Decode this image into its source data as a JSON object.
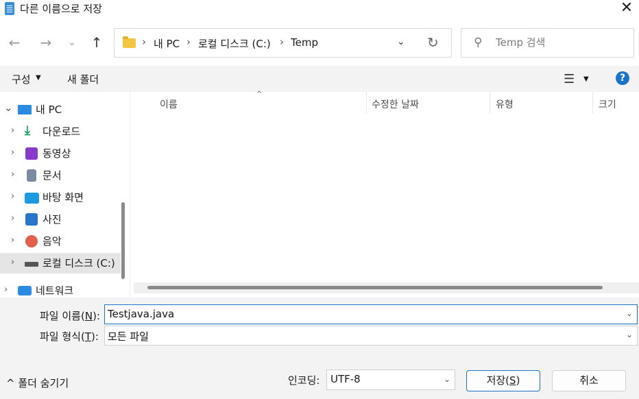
{
  "window": {
    "title": "다른 이름으로 저장",
    "close_glyph": "✕"
  },
  "nav": {
    "back_glyph": "←",
    "forward_glyph": "→",
    "recent_glyph": "⌄",
    "up_glyph": "↑",
    "breadcrumb": [
      "내 PC",
      "로컬 디스크 (C:)",
      "Temp"
    ],
    "crumb_sep": "›",
    "dropdown_glyph": "⌄",
    "refresh_glyph": "↻"
  },
  "search": {
    "placeholder": "Temp 검색",
    "icon": "search-icon"
  },
  "toolbar": {
    "organize_label": "구성",
    "organize_caret": "▼",
    "new_folder_label": "새 폴더",
    "view_glyph": "☰",
    "view_caret": "▼",
    "help_glyph": "?"
  },
  "sidebar": {
    "items": [
      {
        "label": "내 PC",
        "icon": "computer-icon",
        "caret": "⌄",
        "color": "#2a8be0"
      },
      {
        "label": "다운로드",
        "icon": "download-icon",
        "caret": "›",
        "color": "#1aa35a"
      },
      {
        "label": "동영상",
        "icon": "video-icon",
        "caret": "›",
        "color": "#8a3ac9"
      },
      {
        "label": "문서",
        "icon": "document-icon",
        "caret": "›",
        "color": "#7b8aa0"
      },
      {
        "label": "바탕 화면",
        "icon": "desktop-icon",
        "caret": "›",
        "color": "#1e9be0"
      },
      {
        "label": "사진",
        "icon": "pictures-icon",
        "caret": "›",
        "color": "#2675c9"
      },
      {
        "label": "음악",
        "icon": "music-icon",
        "caret": "›",
        "color": "#e0604a"
      },
      {
        "label": "로컬 디스크 (C:)",
        "icon": "drive-icon",
        "caret": "›",
        "color": "#555555"
      },
      {
        "label": "네트워크",
        "icon": "network-icon",
        "caret": "›",
        "color": "#2a8be0"
      }
    ]
  },
  "columns": {
    "headers": [
      "이름",
      "수정한 날짜",
      "유형",
      "크기"
    ],
    "sort_glyph": "^"
  },
  "form": {
    "filename_label_pre": "파일 이름(",
    "filename_key": "N",
    "filename_label_post": "):",
    "filename_value": "Testjava.java",
    "filetype_label_pre": "파일 형식(",
    "filetype_key": "T",
    "filetype_label_post": "):",
    "filetype_value": "모든 파일",
    "caret": "⌄"
  },
  "footer": {
    "hide_folders_glyph": "^",
    "hide_folders_label": "폴더 숨기기",
    "encoding_label": "인코딩:",
    "encoding_value": "UTF-8",
    "encoding_caret": "⌄",
    "save_pre": "저장(",
    "save_key": "S",
    "save_post": ")",
    "cancel_label": "취소"
  },
  "colors": {
    "accent": "#1a73c8",
    "folder": "#f4c542"
  }
}
